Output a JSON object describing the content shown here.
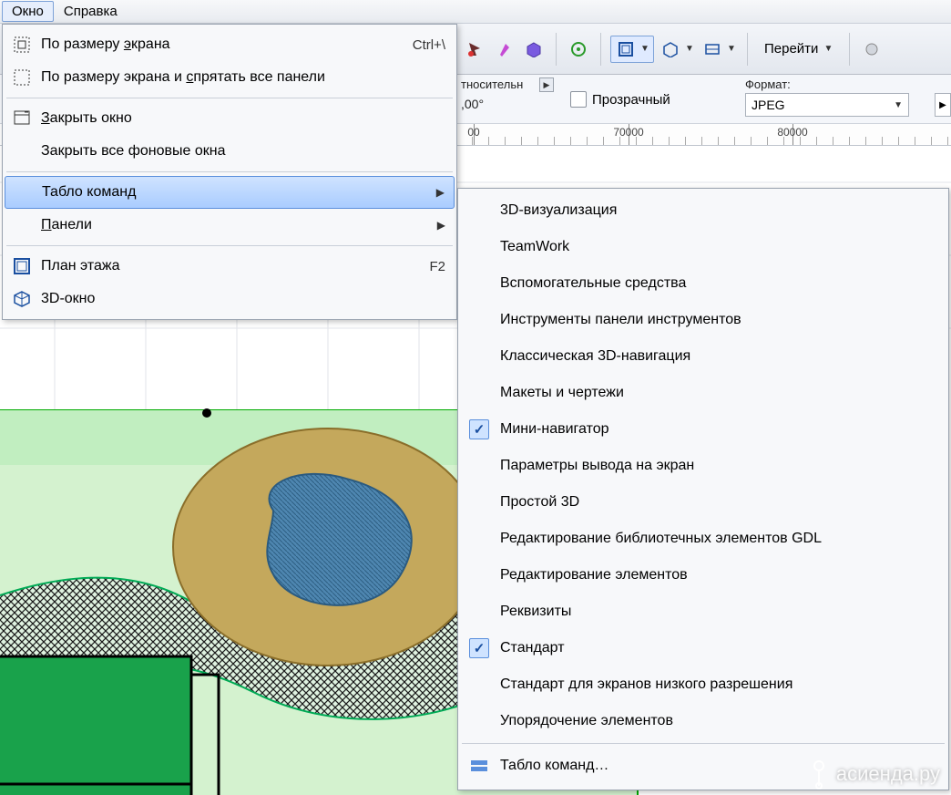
{
  "menubar": {
    "items": [
      {
        "label": "Окно",
        "active": true
      },
      {
        "label": "Справка",
        "active": false
      }
    ]
  },
  "toolbar": {
    "goto_label": "Перейти"
  },
  "props": {
    "relative_label": "тносительн",
    "angle_value": ",00°",
    "transparent_label": "Прозрачный",
    "format_label": "Формат:",
    "format_value": "JPEG"
  },
  "ruler": {
    "ticks": [
      {
        "pos": 520,
        "label": "00"
      },
      {
        "pos": 690,
        "label": "70000"
      },
      {
        "pos": 870,
        "label": "80000"
      }
    ]
  },
  "dropdown": {
    "items": [
      {
        "type": "item",
        "icon": "fit-screen-icon",
        "label_html": "По размеру <u>э</u>крана",
        "shortcut": "Ctrl+\\"
      },
      {
        "type": "item",
        "icon": "fit-hide-icon",
        "label_html": "По размеру экрана и <u>с</u>прятать все панели"
      },
      {
        "type": "sep"
      },
      {
        "type": "item",
        "icon": "close-window-icon",
        "label_html": "<u>З</u>акрыть окно"
      },
      {
        "type": "item",
        "label_html": "Закрыть все фоновые окна"
      },
      {
        "type": "sep"
      },
      {
        "type": "item",
        "highlight": true,
        "submenu": true,
        "label_html": "Табло команд"
      },
      {
        "type": "item",
        "submenu": true,
        "label_html": "<u>П</u>анели"
      },
      {
        "type": "sep"
      },
      {
        "type": "item",
        "icon": "floor-plan-icon",
        "label_html": "План этажа",
        "shortcut": "F2"
      },
      {
        "type": "item",
        "icon": "threed-window-icon",
        "label_html": "3D-окно"
      }
    ]
  },
  "submenu": {
    "items": [
      {
        "label": "3D-визуализация"
      },
      {
        "label": "TeamWork"
      },
      {
        "label": "Вспомогательные средства"
      },
      {
        "label": "Инструменты панели инструментов"
      },
      {
        "label": "Классическая 3D-навигация"
      },
      {
        "label": "Макеты и чертежи"
      },
      {
        "label": "Мини-навигатор",
        "checked": true
      },
      {
        "label": "Параметры вывода на экран"
      },
      {
        "label": "Простой 3D"
      },
      {
        "label": "Редактирование библиотечных элементов GDL"
      },
      {
        "label": "Редактирование элементов"
      },
      {
        "label": "Реквизиты"
      },
      {
        "label": "Стандарт",
        "checked": true
      },
      {
        "label": "Стандарт для экранов низкого разрешения"
      },
      {
        "label": "Упорядочение элементов"
      },
      {
        "type": "sep"
      },
      {
        "label": "Табло команд…",
        "config_icon": true
      }
    ]
  },
  "watermark": "асиенда.ру"
}
